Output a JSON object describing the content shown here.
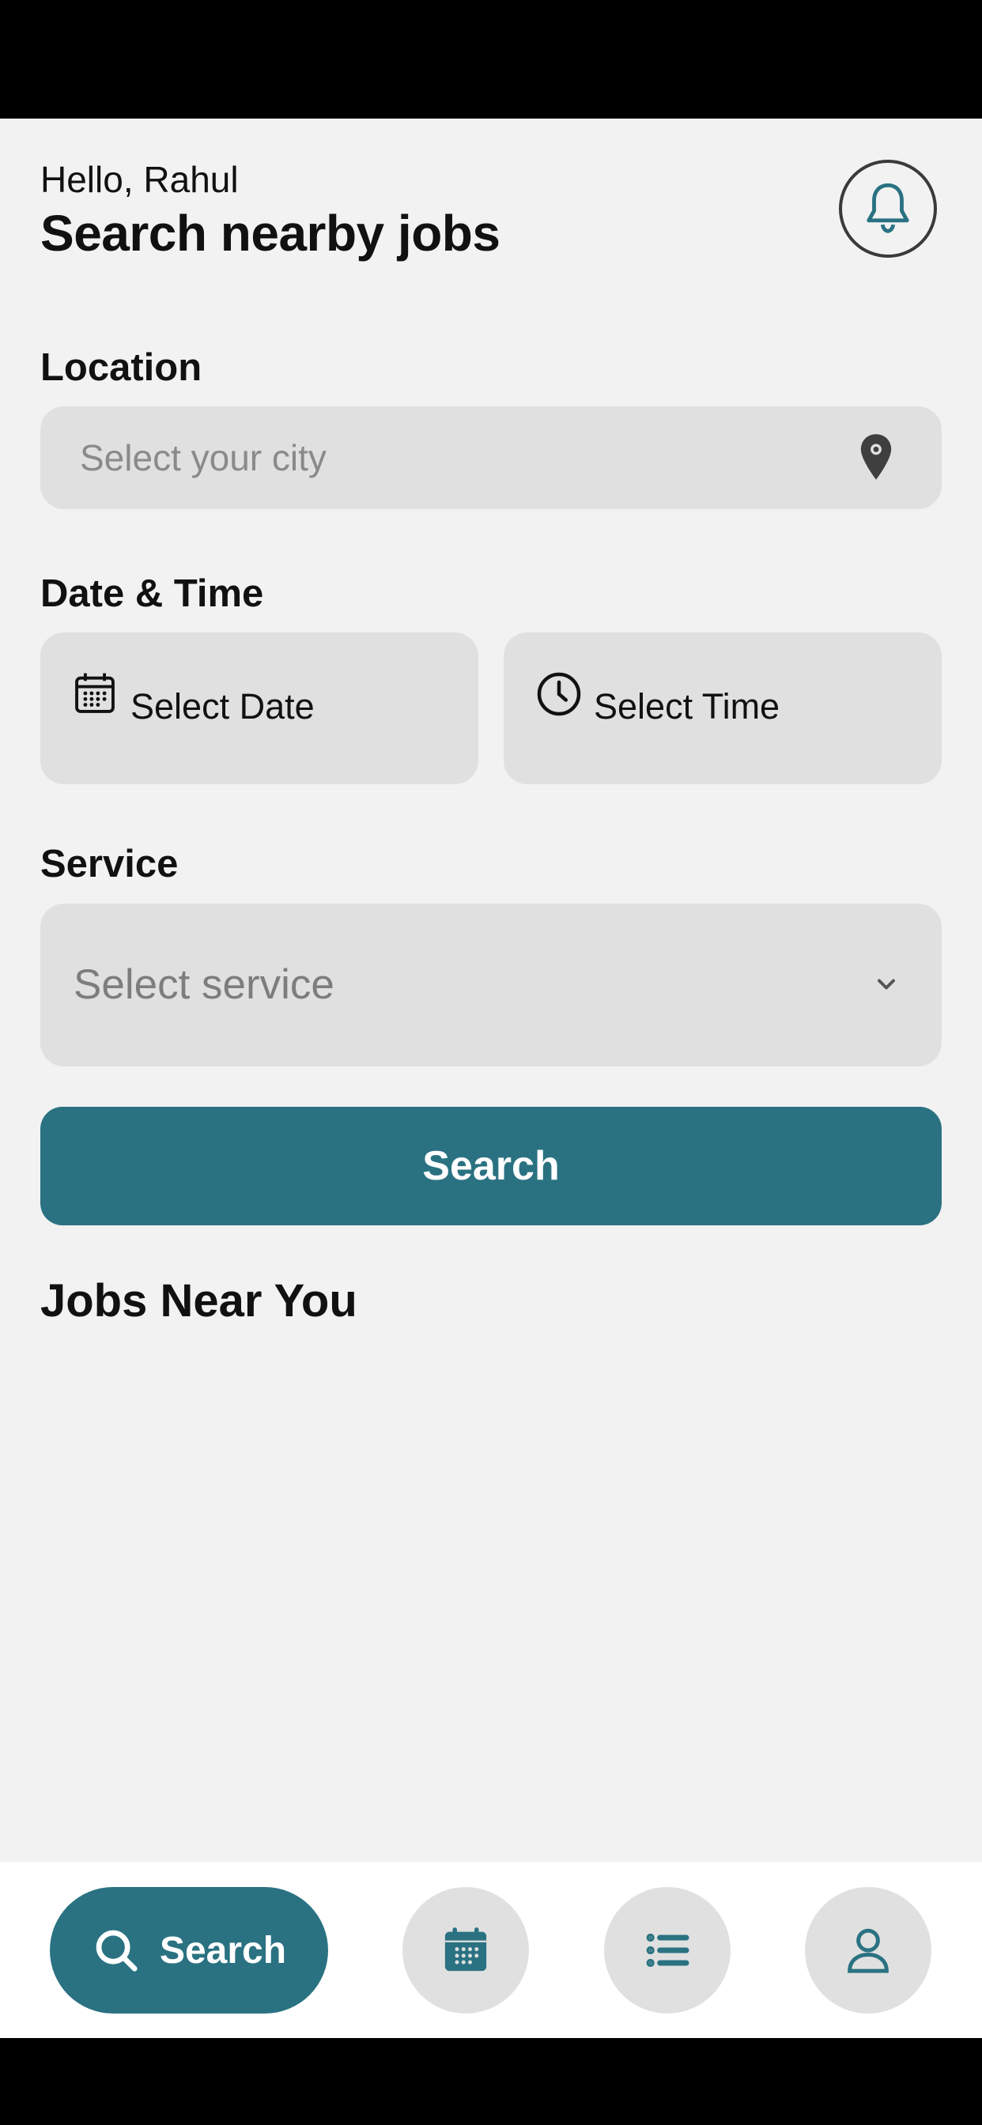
{
  "header": {
    "greeting": "Hello, Rahul",
    "title": "Search nearby jobs",
    "icons": {
      "notifications": "bell-icon"
    }
  },
  "location": {
    "label": "Location",
    "placeholder": "Select your city",
    "icon": "map-pin-icon"
  },
  "datetime": {
    "label": "Date & Time",
    "date_text": "Select Date",
    "time_text": "Select Time",
    "date_icon": "calendar-icon",
    "time_icon": "clock-icon"
  },
  "service": {
    "label": "Service",
    "placeholder": "Select service",
    "icon": "chevron-down-icon"
  },
  "search_button": {
    "label": "Search"
  },
  "jobs_section": {
    "title": "Jobs Near You"
  },
  "bottom_nav": {
    "items": [
      {
        "label": "Search",
        "icon": "search-icon",
        "active": true
      },
      {
        "icon": "calendar-icon"
      },
      {
        "icon": "list-icon"
      },
      {
        "icon": "user-icon"
      }
    ]
  },
  "colors": {
    "accent": "#2a7282",
    "background": "#f2f2f2",
    "field": "#e0e0e0"
  }
}
